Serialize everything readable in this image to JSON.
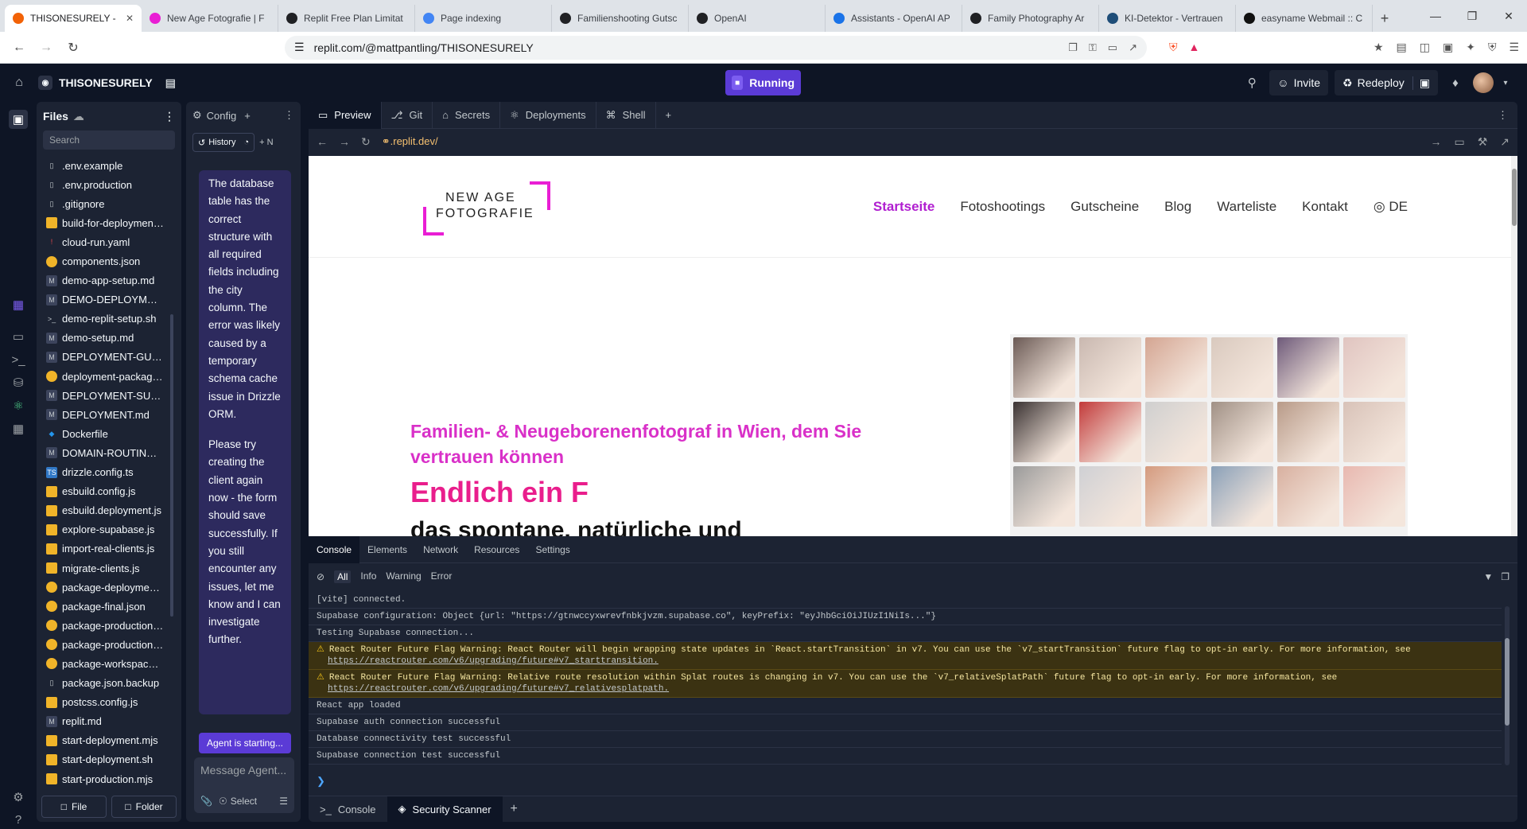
{
  "browser": {
    "tabs": [
      {
        "title": "THISONESURELY -",
        "active": true,
        "favicon": "#f26207"
      },
      {
        "title": "New Age Fotografie | F",
        "favicon": "#e91ed4"
      },
      {
        "title": "Replit Free Plan Limitat",
        "favicon": "#202124"
      },
      {
        "title": "Page indexing",
        "favicon": "#4285f4"
      },
      {
        "title": "Familienshooting Gutsc",
        "favicon": "#202124"
      },
      {
        "title": "OpenAI",
        "favicon": "#202124"
      },
      {
        "title": "Assistants - OpenAI AP",
        "favicon": "#1a73e8"
      },
      {
        "title": "Family Photography Ar",
        "favicon": "#202124"
      },
      {
        "title": "KI-Detektor - Vertrauen",
        "favicon": "#1f4e79"
      },
      {
        "title": "easyname Webmail :: C",
        "favicon": "#111111"
      }
    ],
    "url": "replit.com/@mattpantling/THISONESURELY"
  },
  "topbar": {
    "repl_name": "THISONESURELY",
    "run_label": "Running",
    "invite_label": "Invite",
    "redeploy_label": "Redeploy"
  },
  "files": {
    "title": "Files",
    "search_placeholder": "Search",
    "items": [
      {
        "name": ".env.example",
        "icon": "file-icon"
      },
      {
        "name": ".env.production",
        "icon": "file-icon"
      },
      {
        "name": ".gitignore",
        "icon": "file-icon"
      },
      {
        "name": "build-for-deployment.sh",
        "icon": "js-icon"
      },
      {
        "name": "cloud-run.yaml",
        "icon": "yaml-icon"
      },
      {
        "name": "components.json",
        "icon": "json-icon"
      },
      {
        "name": "demo-app-setup.md",
        "icon": "md-icon"
      },
      {
        "name": "DEMO-DEPLOYMENT.md",
        "icon": "md-icon"
      },
      {
        "name": "demo-replit-setup.sh",
        "icon": "shell-icon"
      },
      {
        "name": "demo-setup.md",
        "icon": "md-icon"
      },
      {
        "name": "DEPLOYMENT-GUIDE.md",
        "icon": "md-icon"
      },
      {
        "name": "deployment-package.json",
        "icon": "json-icon"
      },
      {
        "name": "DEPLOYMENT-SUMMARY.md",
        "icon": "md-icon"
      },
      {
        "name": "DEPLOYMENT.md",
        "icon": "md-icon"
      },
      {
        "name": "Dockerfile",
        "icon": "docker-icon"
      },
      {
        "name": "DOMAIN-ROUTING-FIX.md",
        "icon": "md-icon"
      },
      {
        "name": "drizzle.config.ts",
        "icon": "ts-icon"
      },
      {
        "name": "esbuild.config.js",
        "icon": "js-icon"
      },
      {
        "name": "esbuild.deployment.js",
        "icon": "js-icon"
      },
      {
        "name": "explore-supabase.js",
        "icon": "js-icon"
      },
      {
        "name": "import-real-clients.js",
        "icon": "js-icon"
      },
      {
        "name": "migrate-clients.js",
        "icon": "js-icon"
      },
      {
        "name": "package-deployment.json",
        "icon": "json-icon"
      },
      {
        "name": "package-final.json",
        "icon": "json-icon"
      },
      {
        "name": "package-production.json",
        "icon": "json-icon"
      },
      {
        "name": "package-production-v2.json",
        "icon": "json-icon"
      },
      {
        "name": "package-workspace.json",
        "icon": "json-icon"
      },
      {
        "name": "package.json.backup",
        "icon": "file-icon"
      },
      {
        "name": "postcss.config.js",
        "icon": "js-icon"
      },
      {
        "name": "replit.md",
        "icon": "md-icon"
      },
      {
        "name": "start-deployment.mjs",
        "icon": "js-icon"
      },
      {
        "name": "start-deployment.sh",
        "icon": "js-icon"
      },
      {
        "name": "start-production.mjs",
        "icon": "js-icon"
      }
    ],
    "new_file_label": "File",
    "new_folder_label": "Folder"
  },
  "agent": {
    "tab_label": "Config",
    "history_label": "History",
    "new_label": "N",
    "message_p1": "The database table has the correct structure with all required fields including the city column. The error was likely caused by a temporary schema cache issue in Drizzle ORM.",
    "message_p2": "Please try creating the client again now - the form should save successfully. If you still encounter any issues, let me know and I can investigate further.",
    "status": "Agent is starting...",
    "input_placeholder": "Message Agent...",
    "select_label": "Select"
  },
  "tabs": [
    {
      "label": "Preview",
      "icon": "monitor-icon",
      "active": true
    },
    {
      "label": "Git",
      "icon": "git-icon"
    },
    {
      "label": "Secrets",
      "icon": "lock-icon"
    },
    {
      "label": "Deployments",
      "icon": "deploy-icon"
    },
    {
      "label": "Shell",
      "icon": "shell-icon"
    }
  ],
  "preview": {
    "url": ".replit.dev/",
    "site": {
      "logo_line1": "NEW AGE",
      "logo_line2": "FOTOGRAFIE",
      "nav": [
        "Startseite",
        "Fotoshootings",
        "Gutscheine",
        "Blog",
        "Warteliste",
        "Kontakt",
        "DE"
      ],
      "hero_sub": "Familien- & Neugeborenenfotograf in Wien, dem Sie vertrauen können",
      "hero_title": "Endlich ein F",
      "hero_line2": "das spontane, natürliche und"
    },
    "collage_colors": [
      "#6b5a55",
      "#c9b8b0",
      "#d4a592",
      "#d9c9be",
      "#6e5a7a",
      "#e0c4c0",
      "#3a3232",
      "#c23a3a",
      "#cfcfcf",
      "#a09085",
      "#b89a88",
      "#d8c2b8",
      "#9a9a9a",
      "#cfd0d4",
      "#d49a7e",
      "#8aa0b8",
      "#d8b0a0",
      "#e8b8b0"
    ]
  },
  "devtools": {
    "tabs": [
      "Console",
      "Elements",
      "Network",
      "Resources",
      "Settings"
    ],
    "filters": [
      "All",
      "Info",
      "Warning",
      "Error"
    ],
    "logs": [
      {
        "type": "info",
        "text": "[vite] connected."
      },
      {
        "type": "info",
        "text": "Supabase configuration: ",
        "obj": "Object {url: \"https://gtnwccyxwrevfnbkjvzm.supabase.co\", keyPrefix: \"eyJhbGciOiJIUzI1NiIs...\"}"
      },
      {
        "type": "info",
        "text": "Testing Supabase connection..."
      },
      {
        "type": "warn",
        "text": "React Router Future Flag Warning: React Router will begin wrapping state updates in `React.startTransition` in v7. You can use the `v7_startTransition` future flag to opt-in early. For more information, see",
        "link": "https://reactrouter.com/v6/upgrading/future#v7_starttransition."
      },
      {
        "type": "warn",
        "text": "React Router Future Flag Warning: Relative route resolution within Splat routes is changing in v7. You can use the `v7_relativeSplatPath` future flag to opt-in early. For more information, see",
        "link": "https://reactrouter.com/v6/upgrading/future#v7_relativesplatpath."
      },
      {
        "type": "info",
        "text": "React app loaded"
      },
      {
        "type": "info",
        "text": "Supabase auth connection successful"
      },
      {
        "type": "info",
        "text": "Database connectivity test successful"
      },
      {
        "type": "info",
        "text": "Supabase connection test successful"
      }
    ]
  },
  "bottom_tabs": [
    {
      "label": "Console",
      "icon": "terminal-icon"
    },
    {
      "label": "Security Scanner",
      "icon": "shield-icon",
      "active": true
    }
  ]
}
